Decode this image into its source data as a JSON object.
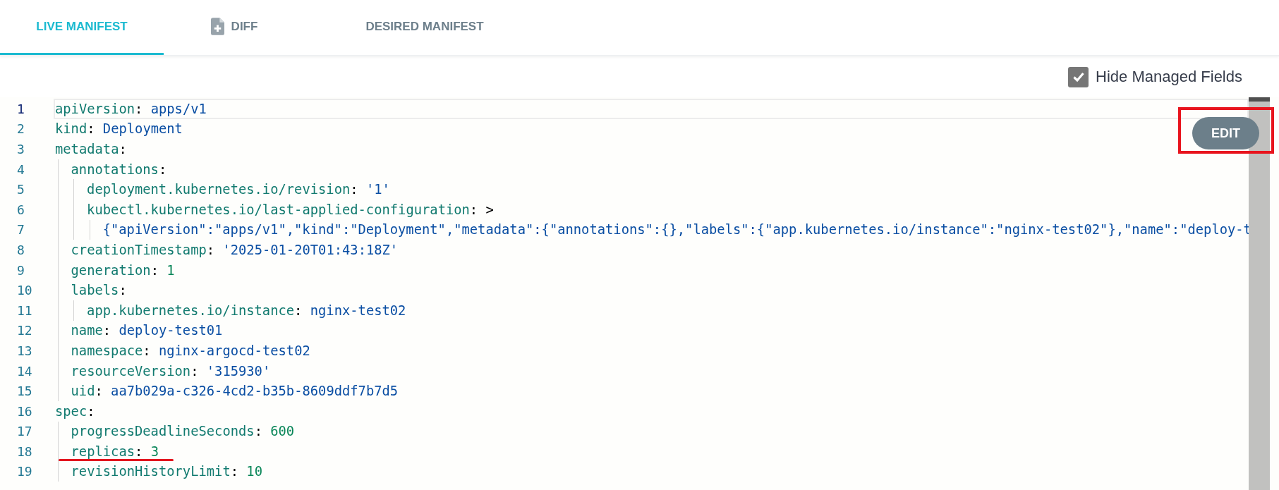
{
  "tabs": [
    {
      "label": "LIVE MANIFEST",
      "selected": true,
      "icon": false
    },
    {
      "label": "DIFF",
      "selected": false,
      "icon": true
    },
    {
      "label": "DESIRED MANIFEST",
      "selected": false,
      "icon": false
    }
  ],
  "hide_managed_fields": {
    "label": "Hide Managed Fields",
    "checked": true
  },
  "edit_button": {
    "label": "EDIT"
  },
  "editor": {
    "lines": [
      {
        "number": "1",
        "current": true,
        "segments": [
          {
            "text": "apiVersion",
            "kind": "key"
          },
          {
            "text": ": ",
            "kind": "punct"
          },
          {
            "text": "apps/v1",
            "kind": "string"
          }
        ]
      },
      {
        "number": "2",
        "current": false,
        "segments": [
          {
            "text": "kind",
            "kind": "key"
          },
          {
            "text": ": ",
            "kind": "punct"
          },
          {
            "text": "Deployment",
            "kind": "string"
          }
        ]
      },
      {
        "number": "3",
        "current": false,
        "segments": [
          {
            "text": "metadata",
            "kind": "key"
          },
          {
            "text": ":",
            "kind": "punct"
          }
        ],
        "children": [
          {
            "number": "4",
            "current": false,
            "segments": [
              {
                "text": "annotations",
                "kind": "key"
              },
              {
                "text": ":",
                "kind": "punct"
              }
            ],
            "children": [
              {
                "number": "5",
                "current": false,
                "segments": [
                  {
                    "text": "deployment.kubernetes.io/revision",
                    "kind": "key"
                  },
                  {
                    "text": ": ",
                    "kind": "punct"
                  },
                  {
                    "text": "'1'",
                    "kind": "string"
                  }
                ]
              },
              {
                "number": "6",
                "current": false,
                "segments": [
                  {
                    "text": "kubectl.kubernetes.io/last-applied-configuration",
                    "kind": "key"
                  },
                  {
                    "text": ": >",
                    "kind": "punct"
                  }
                ],
                "children": [
                  {
                    "number": "7",
                    "current": false,
                    "segments": [
                      {
                        "text": "{\"apiVersion\":\"apps/v1\",\"kind\":\"Deployment\",\"metadata\":{\"annotations\":{},\"labels\":{\"app.kubernetes.io/instance\":\"nginx-test02\"},\"name\":\"deploy-t",
                        "kind": "string"
                      }
                    ]
                  }
                ]
              }
            ]
          },
          {
            "number": "8",
            "current": false,
            "segments": [
              {
                "text": "creationTimestamp",
                "kind": "key"
              },
              {
                "text": ": ",
                "kind": "punct"
              },
              {
                "text": "'2025-01-20T01:43:18Z'",
                "kind": "string"
              }
            ]
          },
          {
            "number": "9",
            "current": false,
            "segments": [
              {
                "text": "generation",
                "kind": "key"
              },
              {
                "text": ": ",
                "kind": "punct"
              },
              {
                "text": "1",
                "kind": "number"
              }
            ]
          },
          {
            "number": "10",
            "current": false,
            "segments": [
              {
                "text": "labels",
                "kind": "key"
              },
              {
                "text": ":",
                "kind": "punct"
              }
            ],
            "children": [
              {
                "number": "11",
                "current": false,
                "segments": [
                  {
                    "text": "app.kubernetes.io/instance",
                    "kind": "key"
                  },
                  {
                    "text": ": ",
                    "kind": "punct"
                  },
                  {
                    "text": "nginx-test02",
                    "kind": "string"
                  }
                ]
              }
            ]
          },
          {
            "number": "12",
            "current": false,
            "segments": [
              {
                "text": "name",
                "kind": "key"
              },
              {
                "text": ": ",
                "kind": "punct"
              },
              {
                "text": "deploy-test01",
                "kind": "string"
              }
            ]
          },
          {
            "number": "13",
            "current": false,
            "segments": [
              {
                "text": "namespace",
                "kind": "key"
              },
              {
                "text": ": ",
                "kind": "punct"
              },
              {
                "text": "nginx-argocd-test02",
                "kind": "string"
              }
            ]
          },
          {
            "number": "14",
            "current": false,
            "segments": [
              {
                "text": "resourceVersion",
                "kind": "key"
              },
              {
                "text": ": ",
                "kind": "punct"
              },
              {
                "text": "'315930'",
                "kind": "string"
              }
            ]
          },
          {
            "number": "15",
            "current": false,
            "segments": [
              {
                "text": "uid",
                "kind": "key"
              },
              {
                "text": ": ",
                "kind": "punct"
              },
              {
                "text": "aa7b029a-c326-4cd2-b35b-8609ddf7b7d5",
                "kind": "string"
              }
            ]
          }
        ]
      },
      {
        "number": "16",
        "current": false,
        "segments": [
          {
            "text": "spec",
            "kind": "key"
          },
          {
            "text": ":",
            "kind": "punct"
          }
        ],
        "children": [
          {
            "number": "17",
            "current": false,
            "segments": [
              {
                "text": "progressDeadlineSeconds",
                "kind": "key"
              },
              {
                "text": ": ",
                "kind": "punct"
              },
              {
                "text": "600",
                "kind": "number"
              }
            ]
          },
          {
            "number": "18",
            "current": false,
            "segments": [
              {
                "text": "replicas",
                "kind": "key"
              },
              {
                "text": ": ",
                "kind": "punct"
              },
              {
                "text": "3",
                "kind": "number"
              }
            ]
          },
          {
            "number": "19",
            "current": false,
            "segments": [
              {
                "text": "revisionHistoryLimit",
                "kind": "key"
              },
              {
                "text": ": ",
                "kind": "punct"
              },
              {
                "text": "10",
                "kind": "number"
              }
            ]
          }
        ]
      }
    ]
  }
}
